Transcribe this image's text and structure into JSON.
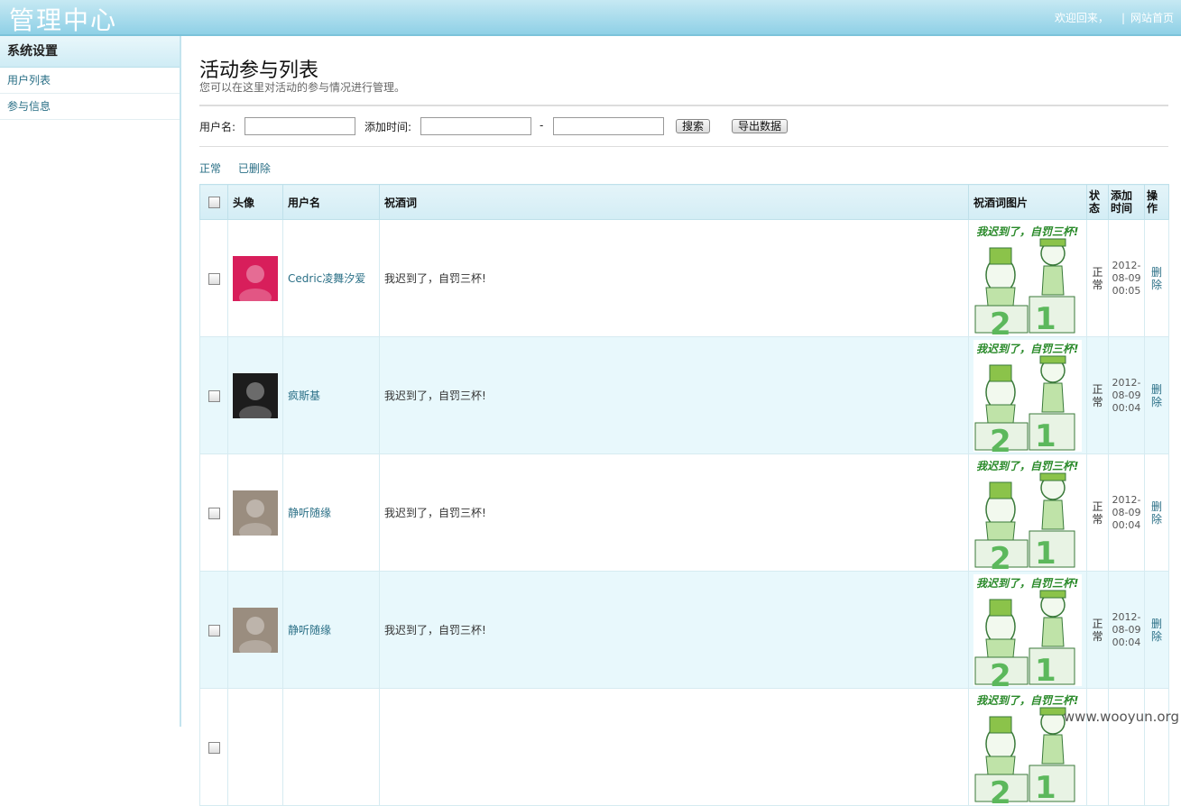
{
  "header": {
    "logo": "管理中心",
    "welcome": "欢迎回来，",
    "separator": "|",
    "home_link": "网站首页"
  },
  "sidebar": {
    "title": "系统设置",
    "items": [
      {
        "label": "用户列表"
      },
      {
        "label": "参与信息"
      }
    ]
  },
  "main": {
    "title": "活动参与列表",
    "subtitle": "您可以在这里对活动的参与情况进行管理。",
    "search": {
      "username_label": "用户名:",
      "username_value": "",
      "time_label": "添加时间:",
      "time_start_value": "",
      "time_dash": "-",
      "time_end_value": "",
      "search_button": "搜索",
      "export_button": "导出数据"
    },
    "filters": [
      "正常",
      "已删除"
    ],
    "table": {
      "columns": {
        "avatar": "头像",
        "username": "用户名",
        "toast": "祝酒词",
        "toast_image": "祝酒词图片",
        "status": "状态",
        "time": "添加时间",
        "action": "操作"
      },
      "toast_image_caption": "我迟到了，自罚三杯!",
      "rows": [
        {
          "username": "Cedric凌舞汐爱",
          "toast": "我迟到了，自罚三杯!",
          "status": "正常",
          "date": "2012-08-09",
          "time": "00:05",
          "action": "删除",
          "avatar_color": "#d81e5b"
        },
        {
          "username": "疯斯基",
          "toast": "我迟到了，自罚三杯!",
          "status": "正常",
          "date": "2012-08-09",
          "time": "00:04",
          "action": "删除",
          "avatar_color": "#1c1c1c"
        },
        {
          "username": "静听随缘",
          "toast": "我迟到了，自罚三杯!",
          "status": "正常",
          "date": "2012-08-09",
          "time": "00:04",
          "action": "删除",
          "avatar_color": "#9a8d7f"
        },
        {
          "username": "静听随缘",
          "toast": "我迟到了，自罚三杯!",
          "status": "正常",
          "date": "2012-08-09",
          "time": "00:04",
          "action": "删除",
          "avatar_color": "#9a8d7f"
        },
        {
          "username": "",
          "toast": "",
          "status": "",
          "date": "",
          "time": "",
          "action": "",
          "avatar_color": "#ffffff"
        }
      ]
    }
  },
  "watermark": "www.wooyun.org"
}
